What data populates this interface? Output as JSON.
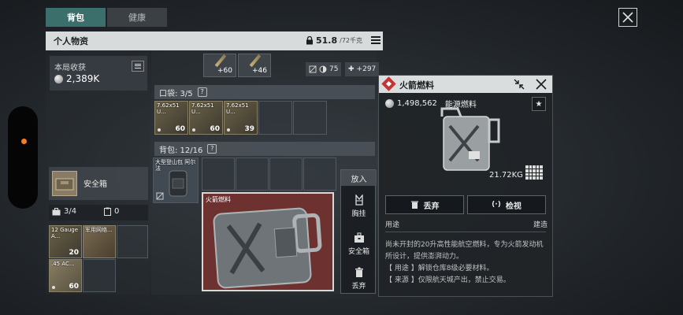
{
  "tabs": [
    {
      "label": "背包",
      "active": true
    },
    {
      "label": "健康",
      "active": false
    }
  ],
  "personal": {
    "title": "个人物资",
    "weight_value": "51.8",
    "weight_max": "/72千克"
  },
  "earnings": {
    "label": "本局收获",
    "value": "2,389K"
  },
  "safebox": {
    "label": "安全箱",
    "slots_used": "3/4",
    "other_count": "0",
    "items": [
      {
        "label": "12 Gauge A...",
        "count": "20"
      },
      {
        "label": "军用网络...",
        "count": ""
      },
      {
        "label": ".45 AC...",
        "count": "60"
      }
    ]
  },
  "ammo_top": [
    {
      "count": "+60"
    },
    {
      "count": "+46"
    }
  ],
  "stats": [
    {
      "icon": "armor-icon",
      "value": "75"
    },
    {
      "icon": "medkit-icon",
      "value": "+297"
    }
  ],
  "pocket": {
    "label": "口袋: 3/5",
    "items": [
      {
        "label": "7.62x51 U...",
        "count": "60"
      },
      {
        "label": "7.62x51 U...",
        "count": "60"
      },
      {
        "label": "7.62x51 U...",
        "count": "39"
      }
    ]
  },
  "backpack": {
    "label": "背包: 12/16",
    "items": [
      {
        "label": "大型登山包 阿尔法",
        "count": ""
      }
    ],
    "selected_label": "火箭燃料"
  },
  "put_menu": {
    "title": "放入",
    "options": [
      {
        "label": "胸挂",
        "icon": "vest-icon"
      },
      {
        "label": "安全箱",
        "icon": "safebox-icon"
      },
      {
        "label": "丢弃",
        "icon": "trash-icon"
      }
    ]
  },
  "detail": {
    "title": "火箭燃料",
    "price": "1,498,562",
    "category": "能源燃料",
    "weight": "21.72KG",
    "discard_label": "丢弃",
    "inspect_label": "检视",
    "use_label": "用途",
    "build_label": "建造",
    "description": [
      "尚未开封的20升高性能航空燃料，专为火箭发动机所设计，提供澎湃动力。",
      "【 用途 】解锁仓库8级必要材料。",
      "【 来源 】仅限航天城产出，禁止交易。"
    ]
  },
  "colors": {
    "accent_tab": "#3a6f6c",
    "selected_item_bg": "#6d3230",
    "badge_red": "#c63333"
  }
}
